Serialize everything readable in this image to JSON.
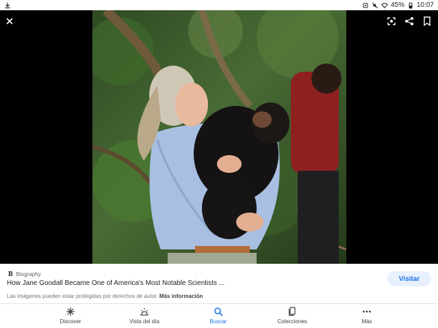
{
  "status_bar": {
    "battery": "45%",
    "time": "10:07",
    "icons": [
      "download-icon",
      "alarm-icon",
      "mute-icon",
      "wifi-icon",
      "battery-icon"
    ]
  },
  "viewer": {
    "close_icon": "close-icon",
    "actions": [
      "lens-icon",
      "share-icon",
      "bookmark-icon"
    ]
  },
  "result": {
    "source_logo": "B",
    "source_name": "Biography",
    "title": "How Jane Goodall Became One of America's Most Notable Scientists ...",
    "notice_text": "Las imágenes pueden estar protegidas por derechos de autor.",
    "notice_link": "Más información",
    "visit_label": "Visitar"
  },
  "nav": {
    "items": [
      {
        "label": "Discover",
        "icon": "asterisk-icon"
      },
      {
        "label": "Vista del día",
        "icon": "sun-icon"
      },
      {
        "label": "Buscar",
        "icon": "search-icon",
        "active": true
      },
      {
        "label": "Colecciones",
        "icon": "collections-icon"
      },
      {
        "label": "Más",
        "icon": "more-icon"
      }
    ]
  },
  "colors": {
    "accent": "#1a73e8",
    "visit_bg": "#e8f0fe",
    "viewer_bg": "#000000"
  }
}
